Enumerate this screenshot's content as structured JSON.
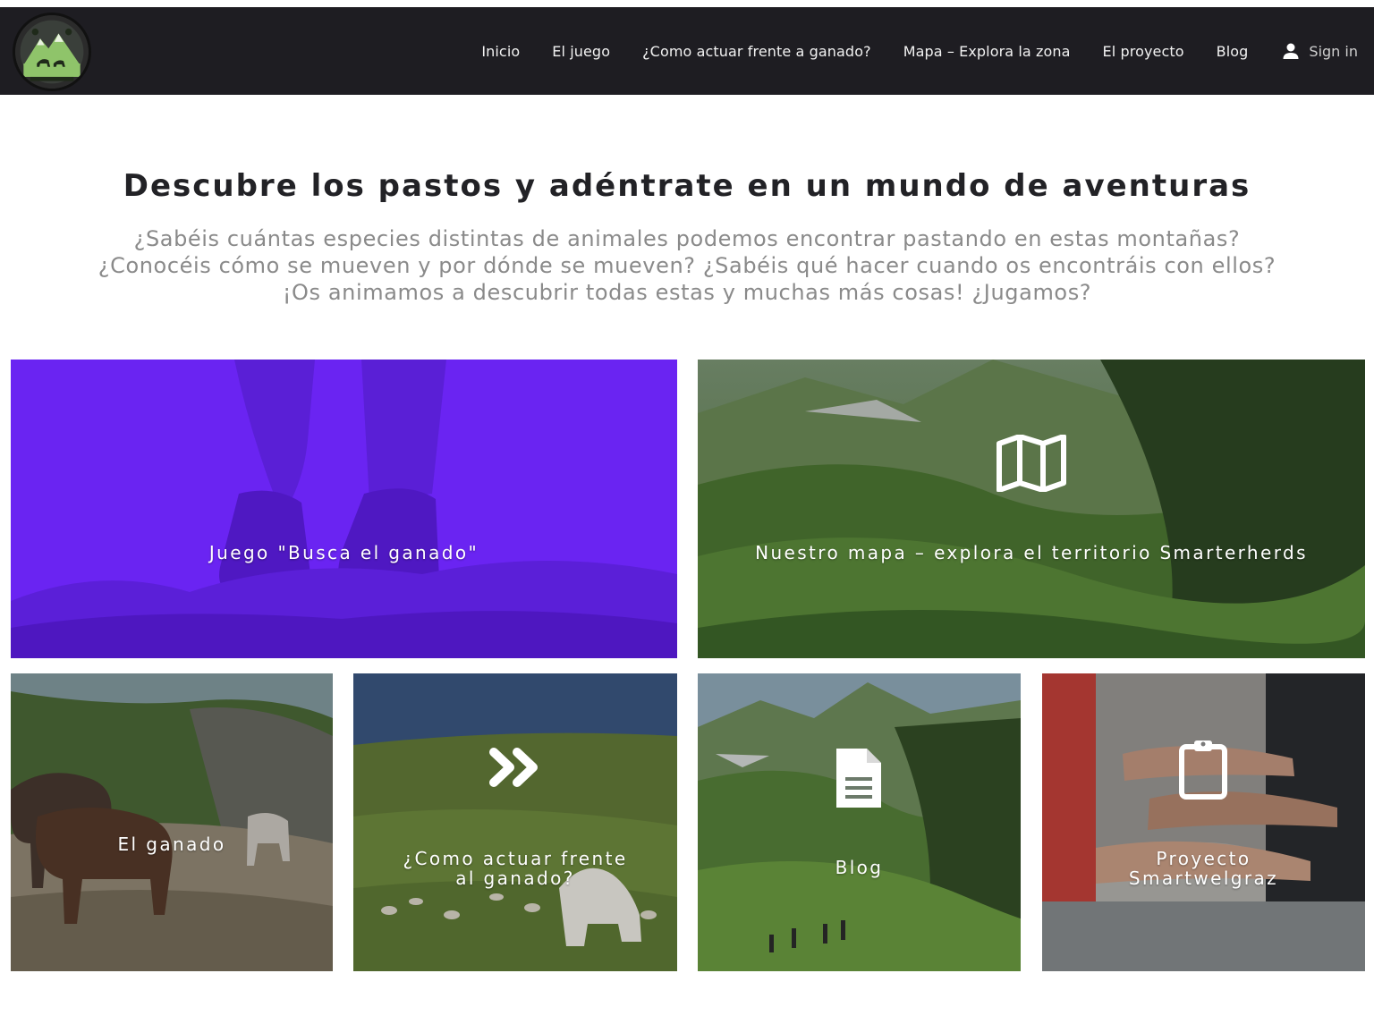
{
  "colors": {
    "navbar": "#1e1d22",
    "nav_text": "#f2f2f2",
    "title": "#222226",
    "subtitle": "#8a8a8a",
    "purple_overlay": "#6a24f2"
  },
  "header": {
    "logo_icon": "smarterherds-logo",
    "nav": [
      {
        "label": "Inicio"
      },
      {
        "label": "El juego"
      },
      {
        "label": "¿Como actuar frente a ganado?"
      },
      {
        "label": "Mapa – Explora la zona"
      },
      {
        "label": "El proyecto"
      },
      {
        "label": "Blog"
      }
    ],
    "signin": {
      "icon": "user-icon",
      "label": "Sign in"
    }
  },
  "hero": {
    "title": "Descubre los pastos y adéntrate en un mundo de aventuras",
    "subtitle_lines": [
      "¿Sabéis cuántas especies distintas de animales podemos encontrar pastando en estas montañas?",
      "¿Conocéis cómo se mueven y por dónde se mueven? ¿Sabéis qué hacer cuando os encontráis con ellos?",
      "¡Os animamos a descubrir todas estas y muchas más cosas! ¿Jugamos?"
    ]
  },
  "tiles": {
    "game": {
      "label": "Juego \"Busca el ganado\""
    },
    "map": {
      "label": "Nuestro mapa – explora el territorio Smarterherds",
      "icon": "map-icon"
    },
    "livestock": {
      "label": "El ganado"
    },
    "howto": {
      "label_line1": "¿Como actuar frente",
      "label_line2": "al ganado?",
      "icon": "double-chevron-right-icon"
    },
    "blog": {
      "label": "Blog",
      "icon": "document-icon"
    },
    "project": {
      "label_line1": "Proyecto",
      "label_line2": "Smartwelgraz",
      "icon": "clipboard-icon"
    }
  }
}
